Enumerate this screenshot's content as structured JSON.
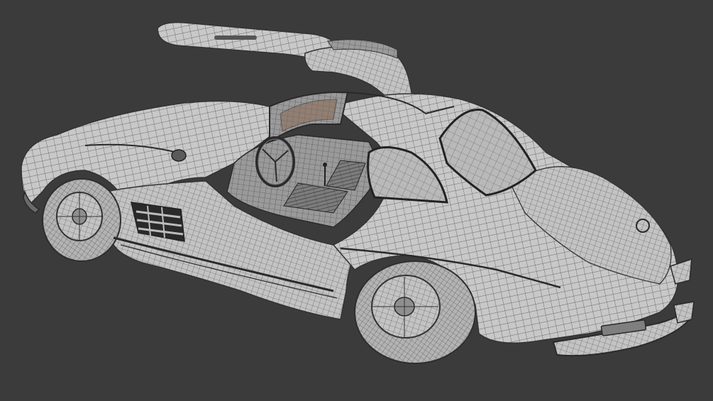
{
  "viewport": {
    "background_color": "#3b3b3b",
    "subject": "car-wireframe-render"
  },
  "model": {
    "surface_color": "#c9c9c9",
    "wire_color": "#4a4a4a",
    "dark_trim_color": "#2a2a2a",
    "glass_color": "#b7b7b7"
  }
}
